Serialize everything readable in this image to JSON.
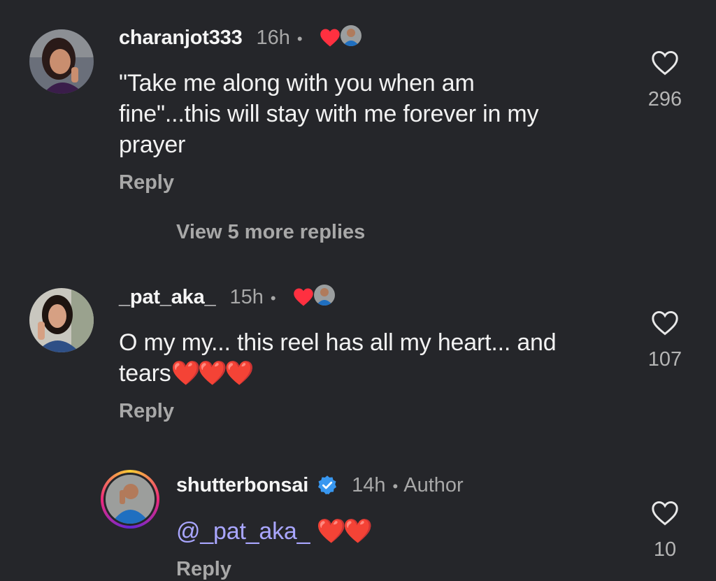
{
  "comments": [
    {
      "username": "charanjot333",
      "time": "16h",
      "dot": "•",
      "text_lines": [
        "\"Take me along with you when am",
        "fine\"...this will stay with me forever in my",
        "prayer"
      ],
      "reply": "Reply",
      "likes": "296",
      "liked_by_creator": true
    },
    {
      "username": "_pat_aka_",
      "time": "15h",
      "dot": "•",
      "text_lines": [
        "O my my... this reel has all my heart... and",
        "tears"
      ],
      "text_emoji": "❤️❤️❤️",
      "reply": "Reply",
      "likes": "107",
      "liked_by_creator": true
    },
    {
      "username": "shutterbonsai",
      "time": "14h",
      "dot": "•",
      "author_label": "Author",
      "verified": true,
      "mention": "@_pat_aka_",
      "text_emoji": "❤️❤️",
      "reply": "Reply",
      "likes": "10"
    }
  ],
  "view_more_replies": "View 5 more replies",
  "colors": {
    "background": "#25262a",
    "heart_red": "#ff3040",
    "mention": "#a9a6ff",
    "verified_blue": "#3897f0",
    "secondary_text": "#a8a8a8"
  },
  "icons": {
    "like": "heart-outline-icon",
    "creator_like": "heart-filled-icon",
    "verified": "verified-badge-icon"
  }
}
